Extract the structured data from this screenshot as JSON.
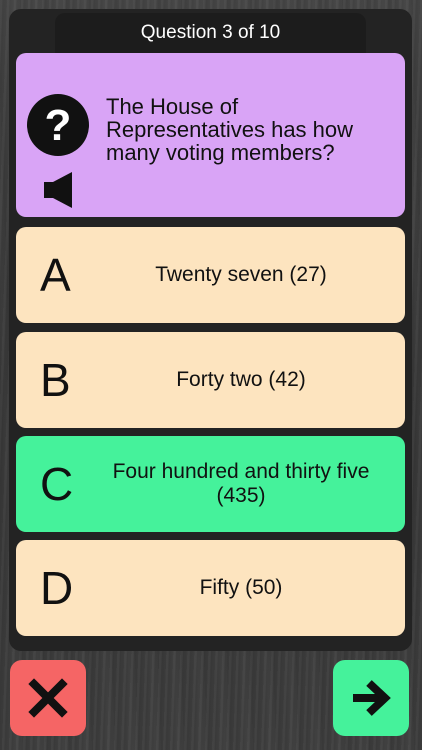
{
  "header": {
    "progress_label": "Question 3 of 10"
  },
  "question": {
    "text": "The House of Representatives has how many voting members?",
    "help_icon": "question-mark-circle-icon",
    "audio_icon": "speaker-icon"
  },
  "answers": [
    {
      "letter": "A",
      "text": "Twenty seven (27)",
      "state": "default"
    },
    {
      "letter": "B",
      "text": "Forty two (42)",
      "state": "default"
    },
    {
      "letter": "C",
      "text": "Four hundred and thirty five (435)",
      "state": "correct"
    },
    {
      "letter": "D",
      "text": "Fifty (50)",
      "state": "default"
    }
  ],
  "controls": {
    "close_icon": "close-x-icon",
    "next_icon": "arrow-right-icon"
  },
  "colors": {
    "question_bg": "#d9a4f6",
    "answer_bg": "#fde4bf",
    "correct_bg": "#45f29b",
    "close_bg": "#f56565",
    "panel_bg": "#232323"
  }
}
